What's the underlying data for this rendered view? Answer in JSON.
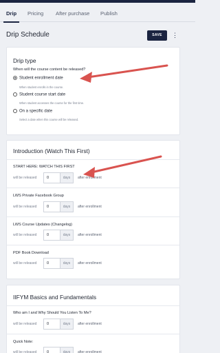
{
  "tabs": [
    {
      "label": "Drip",
      "active": true
    },
    {
      "label": "Pricing",
      "active": false
    },
    {
      "label": "After purchase",
      "active": false
    },
    {
      "label": "Publish",
      "active": false
    }
  ],
  "header": {
    "title": "Drip Schedule",
    "save_label": "SAVE",
    "more_icon": "kebab-menu-icon"
  },
  "drip_type": {
    "title": "Drip type",
    "question": "When will the course content be released?",
    "options": [
      {
        "label": "Student enrollment date",
        "description": "When student enrolls in the course.",
        "selected": true
      },
      {
        "label": "Student course start date",
        "description": "When student accesses the course for the first time.",
        "selected": false
      },
      {
        "label": "On a specific date",
        "description": "Select a date when this course will be released.",
        "selected": false
      }
    ]
  },
  "sections": [
    {
      "title": "Introduction (Watch This First)",
      "lessons": [
        {
          "title": "START HERE: WATCH THIS FIRST",
          "value": "0"
        },
        {
          "title": "LWS Private Facebook Group",
          "value": "0"
        },
        {
          "title": "LWS Course Updates (Changelog)",
          "value": "0"
        },
        {
          "title": "PDF Book Download",
          "value": "0"
        }
      ]
    },
    {
      "title": "IIFYM Basics and Fundamentals",
      "lessons": [
        {
          "title": "Who am I and Why Should You Listen To Me?",
          "value": "0"
        },
        {
          "title": "Quick Note:",
          "value": "0"
        }
      ]
    }
  ],
  "release": {
    "prefix": "will be released",
    "unit": "days",
    "suffix": "after enrollment"
  },
  "colors": {
    "primary": "#1b2440",
    "annotation_arrow": "#d9534f",
    "background": "#eef0f4"
  }
}
